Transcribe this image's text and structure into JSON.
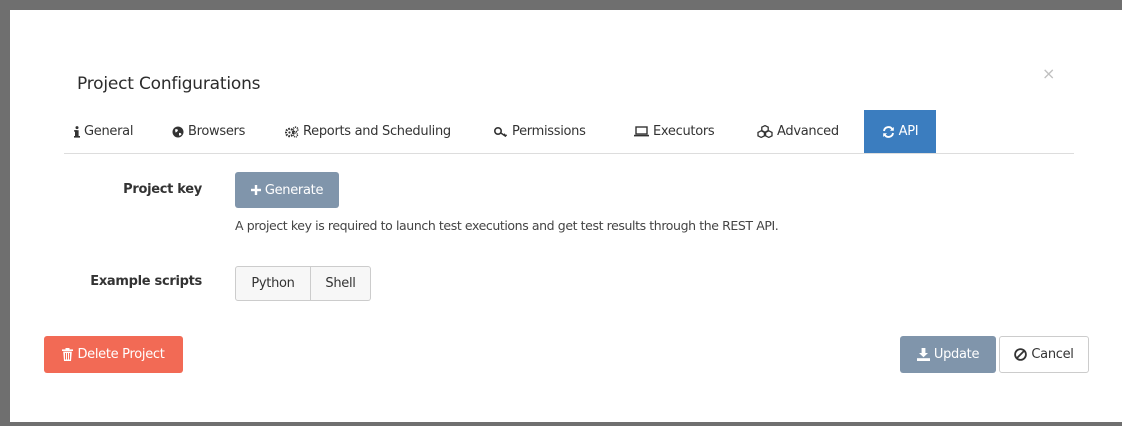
{
  "modal": {
    "title": "Project Configurations",
    "close_label": "×"
  },
  "tabs": [
    {
      "label": "General",
      "icon": "info-icon"
    },
    {
      "label": "Browsers",
      "icon": "globe-icon"
    },
    {
      "label": "Reports and Scheduling",
      "icon": "gears-icon"
    },
    {
      "label": "Permissions",
      "icon": "key-icon"
    },
    {
      "label": "Executors",
      "icon": "laptop-icon"
    },
    {
      "label": "Advanced",
      "icon": "cubes-icon"
    },
    {
      "label": "API",
      "icon": "refresh-icon",
      "active": true
    }
  ],
  "api": {
    "project_key_label": "Project key",
    "generate_label": "Generate",
    "help_text": "A project key is required to launch test executions and get test results through the REST API.",
    "example_scripts_label": "Example scripts",
    "scripts": [
      "Python",
      "Shell"
    ]
  },
  "footer": {
    "delete_label": "Delete Project",
    "update_label": "Update",
    "cancel_label": "Cancel"
  },
  "colors": {
    "active_tab": "#3b7dbf",
    "primary_muted": "#8095ab",
    "danger": "#f26a55"
  }
}
